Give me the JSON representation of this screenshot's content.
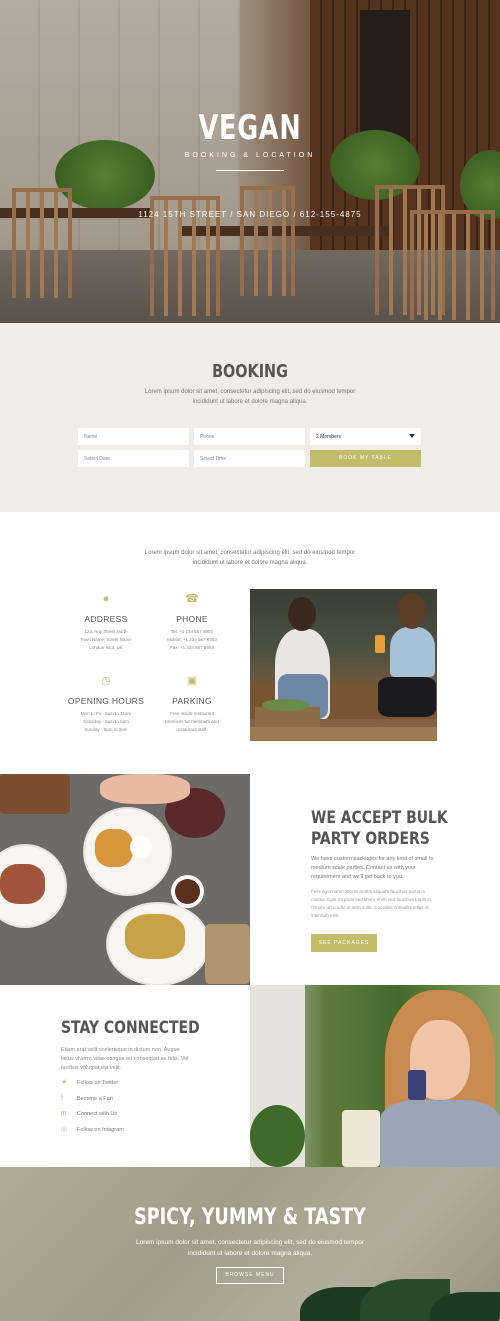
{
  "hero": {
    "title": "VEGAN",
    "subtitle": "BOOKING & LOCATION",
    "address": "1124 15TH STREET / SAN DIEGO / 612-155-4875"
  },
  "booking": {
    "title": "BOOKING",
    "description": "Lorem ipsum dolor sit amet, consectetur adipiscing elit, sed do eiusmod tempor incididunt ut labore et dolore magna aliqua.",
    "name_placeholder": "Name",
    "phone_placeholder": "Phone",
    "members_value": "2 Members",
    "date_placeholder": "Select Date",
    "time_placeholder": "Select Time",
    "button_label": "BOOK MY TABLE"
  },
  "info": {
    "description": "Lorem ipsum dolor sit amet, consectetur adipiscing elit, sed do eiusmod tempor incididunt ut labore et dolore magna aliqua.",
    "address": {
      "heading": "ADDRESS",
      "text": "123, Any Street North\nTown Name, Street Name\nLondon SE3, UK"
    },
    "phone": {
      "heading": "PHONE",
      "text": "Tel: +1 234 567 8901\nMobile: +1 234 567 8953\nFax: +1 234 567 8903"
    },
    "hours": {
      "heading": "OPENING HOURS",
      "text": "Mon to Fri - 8am to 11pm\nSaturday - 8am to 6pm\nSunday - 8am to 2pm"
    },
    "parking": {
      "heading": "PARKING",
      "text": "Free inside restaurant\npremises for members and\nrestaurant staff."
    }
  },
  "bulk": {
    "title": "WE ACCEPT BULK\nPARTY ORDERS",
    "paragraph1": "We have custom packages for any kind of small to medium scale parties. Contact us with your requirement and we'll get back to you.",
    "paragraph2": "Felis eget nunc lobortis mattis aliquam faucibus purus in massa. Eget mi proin sed libero enim sed faucibus turpis in. Ornare arcu odio ut sem nulla. Convallis convallis tellus id interdum velit.",
    "button_label": "SEE PACKAGES"
  },
  "connect": {
    "title": "STAY CONNECTED",
    "description": "Etiam erat velit scelerisque in dictum non. Augue lacus viverra vitae congue eu consequat ac felis. Vel facilisis volutpat est velit.",
    "links": [
      {
        "icon": "twitter-icon",
        "glyph": "★",
        "label": "Follow on Twitter"
      },
      {
        "icon": "facebook-icon",
        "glyph": "f",
        "label": "Become a Fan"
      },
      {
        "icon": "linkedin-icon",
        "glyph": "in",
        "label": "Connect with Us"
      },
      {
        "icon": "instagram-icon",
        "glyph": "◎",
        "label": "Follow on Intagram"
      }
    ]
  },
  "footer": {
    "title": "SPICY, YUMMY & TASTY",
    "description": "Lorem ipsum dolor sit amet, consectetur adipiscing elit, sed do eiusmod tempor incididunt ut labore et dolore magna aliqua.",
    "button_label": "BROWSE MENU"
  },
  "colors": {
    "accent": "#c2bb6a",
    "booking_bg": "#f0ece8",
    "text": "#555555"
  }
}
